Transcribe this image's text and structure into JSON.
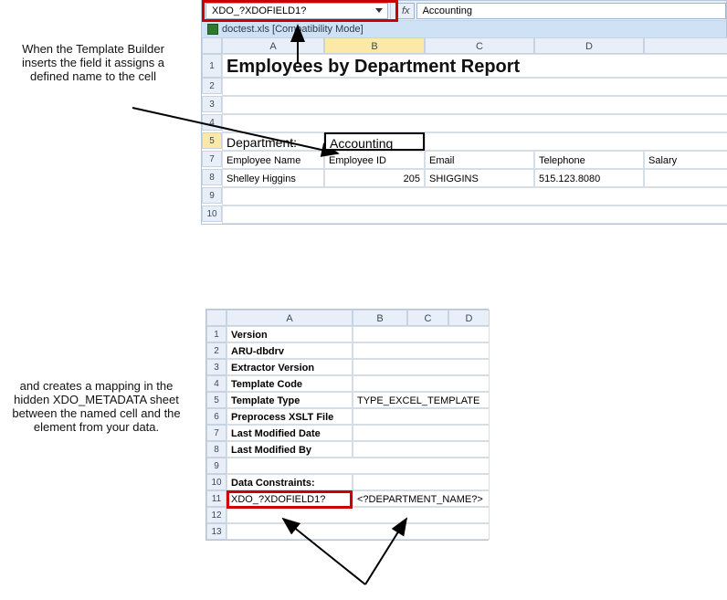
{
  "annotation1": "When the Template Builder inserts the field it assigns a defined name to the cell",
  "annotation2": "and creates a mapping in the hidden XDO_METADATA sheet between the named cell and the element from your data.",
  "top": {
    "namebox_value": "XDO_?XDOFIELD1?",
    "fx_label": "fx",
    "formula_value": "Accounting",
    "doc_title": "doctest.xls  [Compatibility Mode]",
    "cols": [
      "A",
      "B",
      "C",
      "D"
    ],
    "rows": [
      "1",
      "2",
      "3",
      "4",
      "5",
      "7",
      "8",
      "9",
      "10"
    ],
    "title": "Employees by Department Report",
    "dept_label": "Department:",
    "dept_value": "Accounting",
    "headers": [
      "Employee Name",
      "Employee ID",
      "Email",
      "Telephone",
      "Salary"
    ],
    "datarow": {
      "name": "Shelley Higgins",
      "id": "205",
      "email": "SHIGGINS",
      "tel": "515.123.8080"
    }
  },
  "bottom": {
    "cols": [
      "A",
      "B",
      "C",
      "D"
    ],
    "rows": [
      "1",
      "2",
      "3",
      "4",
      "5",
      "6",
      "7",
      "8",
      "9",
      "10",
      "11",
      "12",
      "13"
    ],
    "colA": {
      "r1": "Version",
      "r2": "ARU-dbdrv",
      "r3": "Extractor Version",
      "r4": "Template Code",
      "r5": "Template Type",
      "r6": "Preprocess XSLT File",
      "r7": "Last Modified Date",
      "r8": "Last Modified By",
      "r10": "Data Constraints:",
      "r11": "XDO_?XDOFIELD1?"
    },
    "colB": {
      "r5": "TYPE_EXCEL_TEMPLATE",
      "r11": "<?DEPARTMENT_NAME?>"
    }
  }
}
